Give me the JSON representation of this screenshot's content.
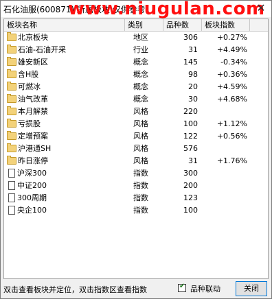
{
  "window": {
    "title": "石化油服(600871) 所属板块 仅供参考",
    "watermark": "www.niugulan.com",
    "close_glyph": "✕"
  },
  "table": {
    "headers": [
      "板块名称",
      "类别",
      "品种数",
      "板块指数"
    ],
    "rows": [
      {
        "icon": "folder",
        "name": "北京板块",
        "type": "地区",
        "count": "306",
        "index": "+0.27%"
      },
      {
        "icon": "folder",
        "name": "石油-石油开采",
        "type": "行业",
        "count": "31",
        "index": "+4.49%"
      },
      {
        "icon": "folder",
        "name": "雄安新区",
        "type": "概念",
        "count": "145",
        "index": "-0.34%"
      },
      {
        "icon": "folder",
        "name": "含H股",
        "type": "概念",
        "count": "98",
        "index": "+0.36%"
      },
      {
        "icon": "folder",
        "name": "可燃冰",
        "type": "概念",
        "count": "20",
        "index": "+4.59%"
      },
      {
        "icon": "folder",
        "name": "油气改革",
        "type": "概念",
        "count": "30",
        "index": "+4.68%"
      },
      {
        "icon": "folder",
        "name": "本月解禁",
        "type": "风格",
        "count": "220",
        "index": ""
      },
      {
        "icon": "folder",
        "name": "亏损股",
        "type": "风格",
        "count": "100",
        "index": "+1.12%"
      },
      {
        "icon": "folder",
        "name": "定增预案",
        "type": "风格",
        "count": "122",
        "index": "+0.56%"
      },
      {
        "icon": "folder",
        "name": "沪港通SH",
        "type": "风格",
        "count": "576",
        "index": ""
      },
      {
        "icon": "folder",
        "name": "昨日涨停",
        "type": "风格",
        "count": "31",
        "index": "+1.76%"
      },
      {
        "icon": "doc",
        "name": "沪深300",
        "type": "指数",
        "count": "300",
        "index": ""
      },
      {
        "icon": "doc",
        "name": "中证200",
        "type": "指数",
        "count": "200",
        "index": ""
      },
      {
        "icon": "doc",
        "name": "300周期",
        "type": "指数",
        "count": "123",
        "index": ""
      },
      {
        "icon": "doc",
        "name": "央企100",
        "type": "指数",
        "count": "100",
        "index": ""
      }
    ]
  },
  "status": {
    "hint": "双击查看板块并定位，双击指数区查看指数",
    "checkbox_label": "品种联动",
    "checkbox_checked": true,
    "close_button": "关闭"
  }
}
